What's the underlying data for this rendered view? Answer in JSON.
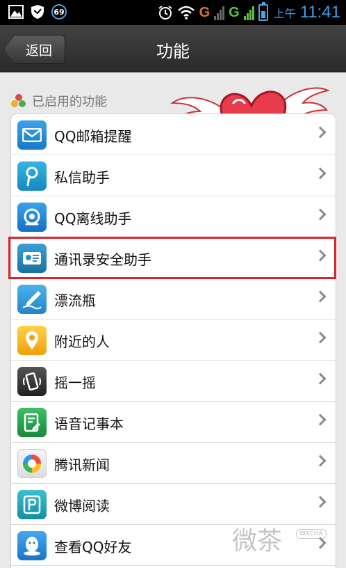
{
  "status_bar": {
    "notification_count": "69",
    "network_g1": "G",
    "network_g2": "G",
    "ampm": "上午",
    "time": "11:41",
    "accent_color": "#3fa0e8"
  },
  "titlebar": {
    "back_label": "返回",
    "title": "功能"
  },
  "section": {
    "header": "已启用的功能"
  },
  "list": {
    "items": [
      {
        "label": "QQ邮箱提醒",
        "icon": "mail-icon",
        "color": "#2d8fd8"
      },
      {
        "label": "私信助手",
        "icon": "private-message-icon",
        "color": "#1e9bd0"
      },
      {
        "label": "QQ离线助手",
        "icon": "offline-assistant-icon",
        "color": "#1f8fd6"
      },
      {
        "label": "通讯录安全助手",
        "icon": "contacts-security-icon",
        "color": "#2a8fc9"
      },
      {
        "label": "漂流瓶",
        "icon": "drift-bottle-icon",
        "color": "#3b9fd6"
      },
      {
        "label": "附近的人",
        "icon": "location-pin-icon",
        "color": "#f5b820"
      },
      {
        "label": "摇一摇",
        "icon": "shake-phone-icon",
        "color": "#3a3a3a"
      },
      {
        "label": "语音记事本",
        "icon": "voice-notepad-icon",
        "color": "#21a34a"
      },
      {
        "label": "腾讯新闻",
        "icon": "tencent-news-icon",
        "color": "#e8e8e8"
      },
      {
        "label": "微博阅读",
        "icon": "weibo-reader-icon",
        "color": "#1fa6b8"
      },
      {
        "label": "查看QQ好友",
        "icon": "qq-friends-icon",
        "color": "#2e8fd9"
      }
    ],
    "highlighted_item": "通讯录安全助手",
    "highlight_color": "#e0202a"
  },
  "watermark": {
    "text": "微茶",
    "badge": "WXCHA"
  }
}
